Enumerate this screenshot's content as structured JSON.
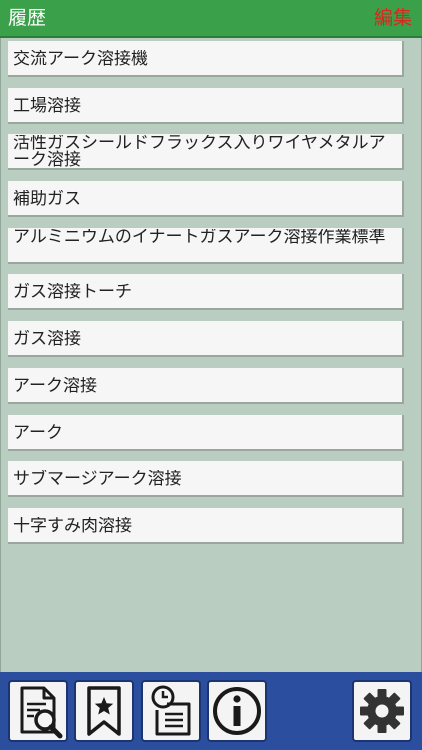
{
  "header": {
    "title": "履歴",
    "edit_label": "編集"
  },
  "history": {
    "items": [
      {
        "label": "交流アーク溶接機"
      },
      {
        "label": "工場溶接"
      },
      {
        "label": "活性ガスシールドフラックス入りワイヤメタルアーク溶接"
      },
      {
        "label": "補助ガス"
      },
      {
        "label": "アルミニウムのイナートガスアーク溶接作業標準"
      },
      {
        "label": "ガス溶接トーチ"
      },
      {
        "label": "ガス溶接"
      },
      {
        "label": "アーク溶接"
      },
      {
        "label": "アーク"
      },
      {
        "label": "サブマージアーク溶接"
      },
      {
        "label": "十字すみ肉溶接"
      }
    ]
  },
  "toolbar": {
    "buttons": [
      {
        "icon": "document-search-icon"
      },
      {
        "icon": "bookmark-star-icon"
      },
      {
        "icon": "history-clock-list-icon"
      },
      {
        "icon": "info-icon"
      },
      {
        "icon": "gear-icon"
      }
    ]
  },
  "colors": {
    "header_bg": "#3aa04a",
    "edit_text": "#d42a1e",
    "content_bg": "#b9cdc0",
    "bottom_bar_bg": "#2b4f9e"
  }
}
